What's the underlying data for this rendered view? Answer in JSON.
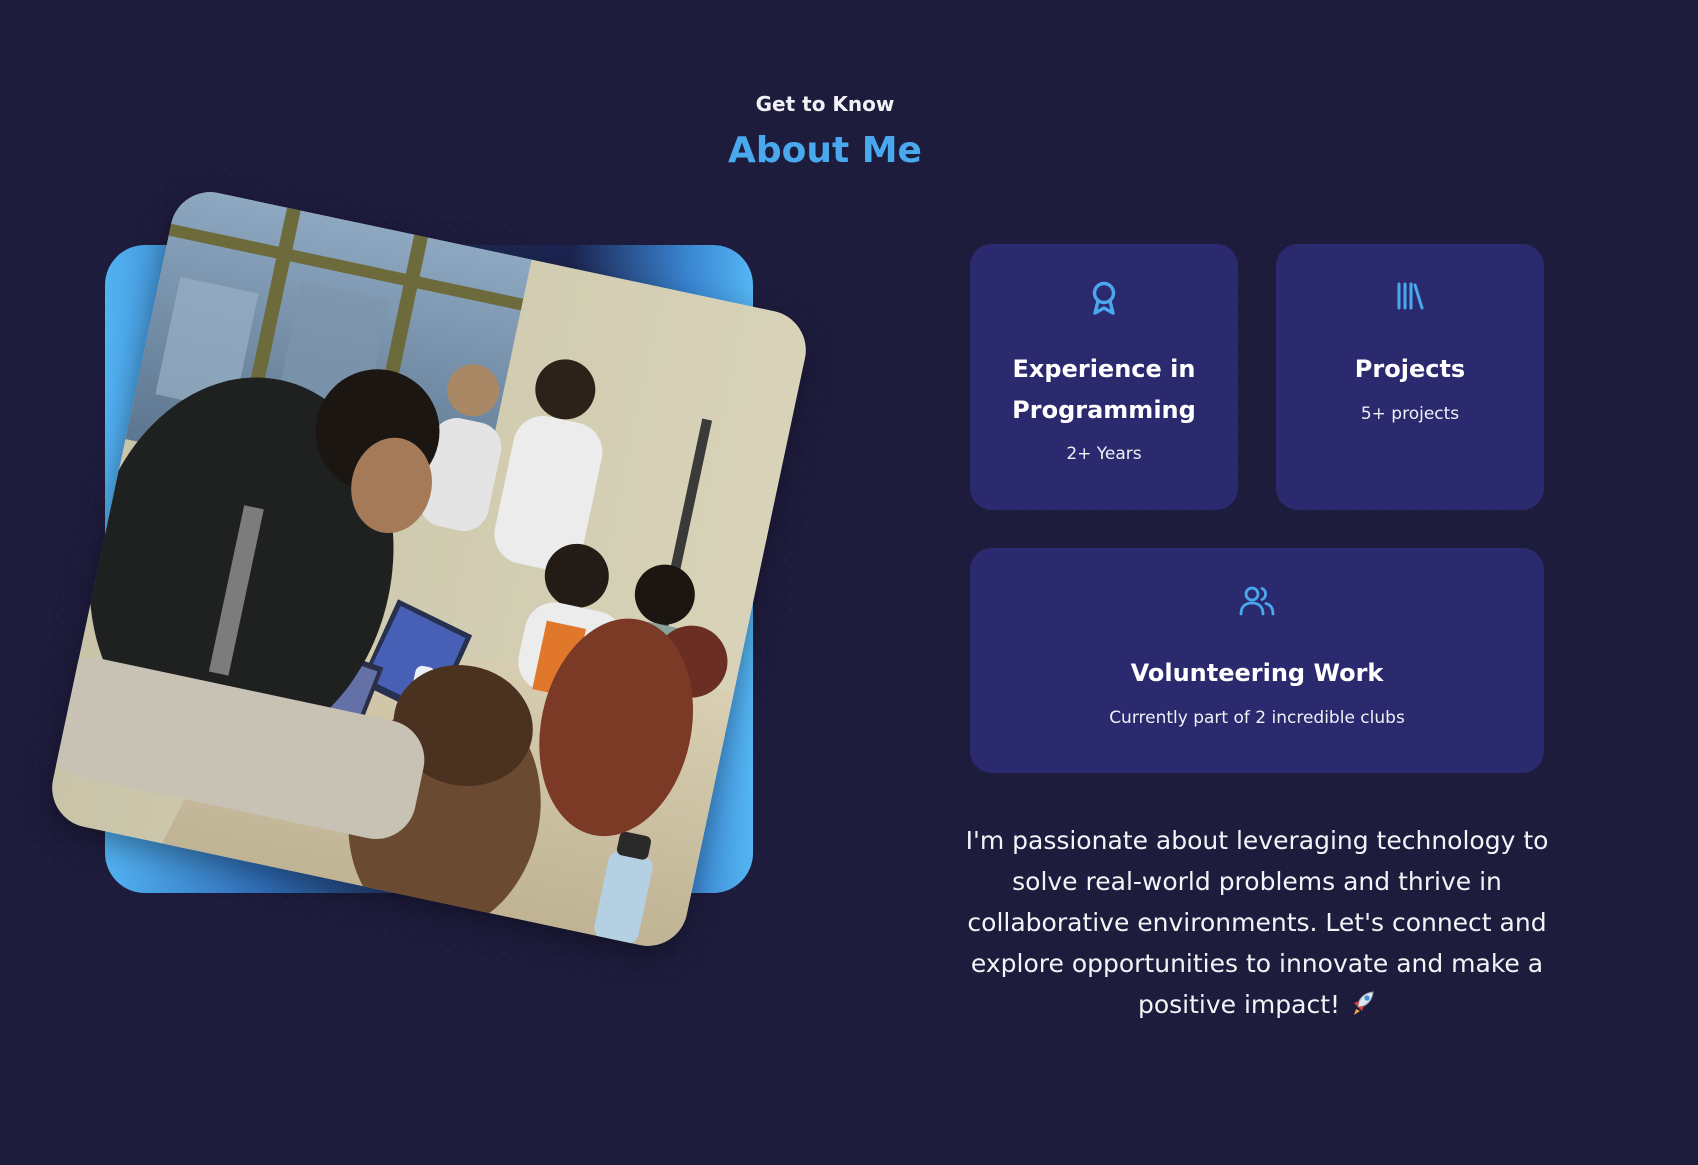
{
  "header": {
    "eyebrow": "Get to Know",
    "title": "About Me"
  },
  "photo": {
    "alt_description_icon": "classroom-photo"
  },
  "cards": {
    "experience": {
      "icon": "award-icon",
      "title": "Experience in Programming",
      "subtitle": "2+ Years"
    },
    "projects": {
      "icon": "library-icon",
      "title": "Projects",
      "subtitle": "5+ projects"
    },
    "volunteering": {
      "icon": "users-icon",
      "title": "Volunteering Work",
      "subtitle": "Currently part of 2 incredible clubs"
    }
  },
  "bio": {
    "text": "I'm passionate about leveraging technology to solve real-world problems and thrive in collaborative environments. Let's connect and explore opportunities to innovate and make a positive impact!",
    "emoji": "rocket-icon"
  },
  "colors": {
    "background": "#1e1c3d",
    "card": "#2c2a6f",
    "accent": "#4aa9ee",
    "text": "#ffffff"
  }
}
